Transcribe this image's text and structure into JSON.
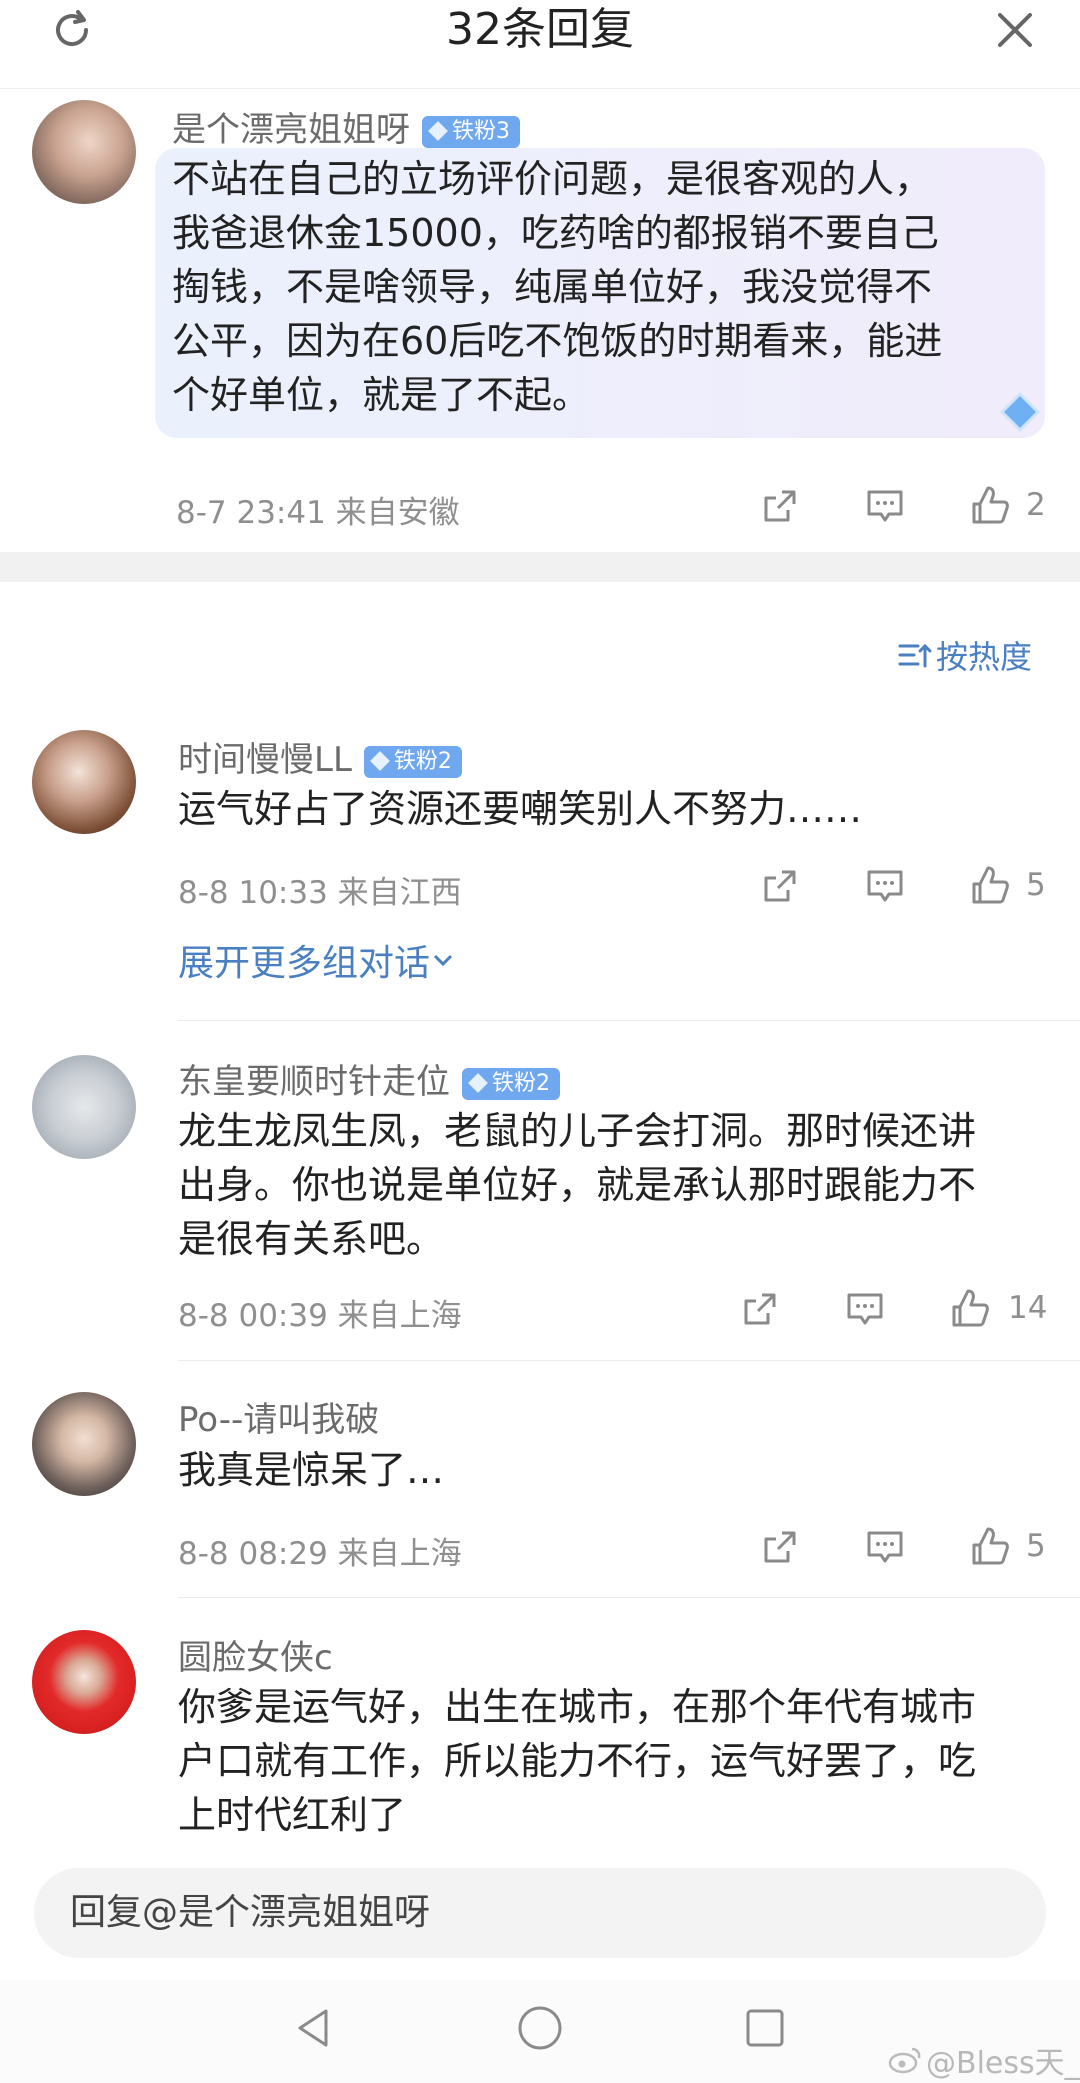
{
  "header": {
    "title": "32条回复",
    "refresh_icon": "refresh-icon",
    "close_icon": "close-icon"
  },
  "main_comment": {
    "username": "是个漂亮姐姐呀",
    "badge": "铁粉3",
    "text_lines": [
      "不站在自己的立场评价问题，是很客观的人，",
      "我爸退休金15000，吃药啥的都报销不要自己",
      "掏钱，不是啥领导，纯属单位好，我没觉得不",
      "公平，因为在60后吃不饱饭的时期看来，能进",
      "个好单位，就是了不起。"
    ],
    "meta": "8-7 23:41  来自安徽",
    "likes": "2"
  },
  "sort_label": "按热度",
  "replies": [
    {
      "username": "时间慢慢LL",
      "badge": "铁粉2",
      "text_lines": [
        "运气好占了资源还要嘲笑别人不努力……"
      ],
      "meta": "8-8 10:33  来自江西",
      "likes": "5",
      "expand": "展开更多组对话"
    },
    {
      "username": "东皇要顺时针走位",
      "badge": "铁粉2",
      "text_lines": [
        "龙生龙凤生凤，老鼠的儿子会打洞。那时候还讲",
        "出身。你也说是单位好，就是承认那时跟能力不",
        "是很有关系吧。"
      ],
      "meta": "8-8 00:39  来自上海",
      "likes": "14"
    },
    {
      "username": "Po--请叫我破",
      "text_lines": [
        "我真是惊呆了…"
      ],
      "meta": "8-8 08:29  来自上海",
      "likes": "5"
    },
    {
      "username": "圆脸女侠c",
      "text_lines": [
        "你爹是运气好，出生在城市，在那个年代有城市",
        "户口就有工作，所以能力不行，运气好罢了，吃",
        "上时代红利了"
      ]
    }
  ],
  "reply_input": {
    "placeholder": "回复@是个漂亮姐姐呀"
  },
  "watermark": "@Bless天_",
  "colors": {
    "link": "#4a7fc2",
    "badge": "#6fa8ee",
    "meta": "#8f8f8f"
  }
}
